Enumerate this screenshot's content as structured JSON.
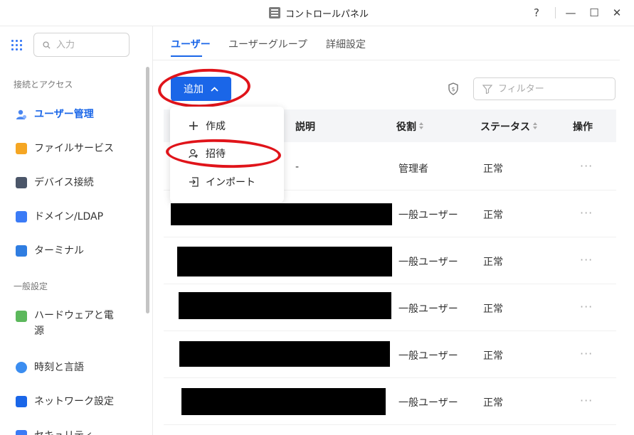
{
  "window": {
    "title": "コントロールパネル",
    "controls": {
      "help": "?",
      "minimize": "—",
      "maximize": "☐",
      "close": "✕"
    }
  },
  "sidebar": {
    "search_placeholder": "入力",
    "sections": [
      {
        "title": "接続とアクセス"
      },
      {
        "title": "一般設定"
      }
    ],
    "items": [
      {
        "label": "ユーザー管理",
        "icon": "user-management-icon",
        "active": true
      },
      {
        "label": "ファイルサービス",
        "icon": "folder-icon"
      },
      {
        "label": "デバイス接続",
        "icon": "device-icon"
      },
      {
        "label": "ドメイン/LDAP",
        "icon": "domain-icon"
      },
      {
        "label": "ターミナル",
        "icon": "terminal-icon"
      },
      {
        "label": "ハードウェアと電",
        "label2": "源",
        "icon": "hardware-power-icon"
      },
      {
        "label": "時刻と言語",
        "icon": "globe-icon"
      },
      {
        "label": "ネットワーク設定",
        "icon": "network-icon"
      },
      {
        "label": "セキュリティ",
        "icon": "security-icon"
      }
    ]
  },
  "tabs": [
    {
      "label": "ユーザー",
      "active": true
    },
    {
      "label": "ユーザーグループ"
    },
    {
      "label": "詳細設定"
    }
  ],
  "toolbar": {
    "add_label": "追加",
    "filter_placeholder": "フィルター"
  },
  "dropdown": {
    "items": [
      {
        "label": "作成",
        "icon": "plus-icon"
      },
      {
        "label": "招待",
        "icon": "invite-user-icon"
      },
      {
        "label": "インポート",
        "icon": "import-icon"
      }
    ]
  },
  "table": {
    "columns": [
      "説明",
      "役割",
      "ステータス",
      "操作"
    ],
    "rows": [
      {
        "description": "-",
        "role": "管理者",
        "status": "正常",
        "actions": "···"
      },
      {
        "description": "",
        "role": "一般ユーザー",
        "status": "正常",
        "actions": "···"
      },
      {
        "description": "",
        "role": "一般ユーザー",
        "status": "正常",
        "actions": "···"
      },
      {
        "description": "",
        "role": "一般ユーザー",
        "status": "正常",
        "actions": "···"
      },
      {
        "description": "",
        "role": "一般ユーザー",
        "status": "正常",
        "actions": "···"
      },
      {
        "description": "",
        "role": "一般ユーザー",
        "status": "正常",
        "actions": "···"
      }
    ]
  },
  "colors": {
    "accent": "#1a66e8",
    "annotation": "#e0141a"
  }
}
